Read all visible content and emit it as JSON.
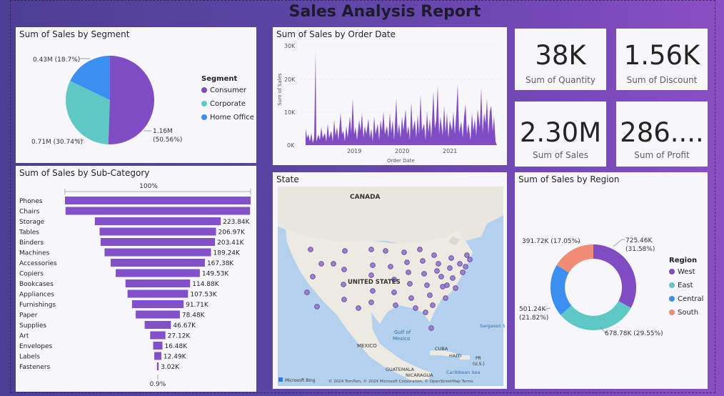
{
  "report_title": "Sales Analysis Report",
  "colors": {
    "consumer": "#7f4cc4",
    "corporate": "#5ec9c4",
    "home_office": "#3b8ff0",
    "south": "#f28b73",
    "bar": "#8250c8"
  },
  "segment": {
    "title": "Sum of Sales by Segment",
    "legend_title": "Segment",
    "legend": [
      "Consumer",
      "Corporate",
      "Home Office"
    ],
    "labels": {
      "consumer_1": "1.16M",
      "consumer_2": "(50.56%)",
      "corporate": "0.71M (30.74%)",
      "home_office": "0.43M (18.7%)"
    }
  },
  "order_date": {
    "title": "Sum of Sales by Order Date",
    "y_label": "Sum of Sales",
    "x_label": "Order Date",
    "y_ticks": [
      "30K",
      "20K",
      "10K",
      "0K"
    ],
    "x_ticks": [
      "2019",
      "2020",
      "2021"
    ]
  },
  "kpis": [
    {
      "value": "38K",
      "label": "Sum of Quantity"
    },
    {
      "value": "1.56K",
      "label": "Sum of Discount"
    },
    {
      "value": "2.30M",
      "label": "Sum of Sales"
    },
    {
      "value": "286....",
      "label": "Sum of Profit"
    }
  ],
  "subcategory": {
    "title": "Sum of Sales by Sub-Category",
    "top_pct": "100%",
    "bottom_pct": "0.9%",
    "items": [
      {
        "name": "Phones",
        "label": ""
      },
      {
        "name": "Chairs",
        "label": ""
      },
      {
        "name": "Storage",
        "label": "223.84K"
      },
      {
        "name": "Tables",
        "label": "206.97K"
      },
      {
        "name": "Binders",
        "label": "203.41K"
      },
      {
        "name": "Machines",
        "label": "189.24K"
      },
      {
        "name": "Accessories",
        "label": "167.38K"
      },
      {
        "name": "Copiers",
        "label": "149.53K"
      },
      {
        "name": "Bookcases",
        "label": "114.88K"
      },
      {
        "name": "Appliances",
        "label": "107.53K"
      },
      {
        "name": "Furnishings",
        "label": "91.71K"
      },
      {
        "name": "Paper",
        "label": "78.48K"
      },
      {
        "name": "Supplies",
        "label": "46.67K"
      },
      {
        "name": "Art",
        "label": "27.12K"
      },
      {
        "name": "Envelopes",
        "label": "16.48K"
      },
      {
        "name": "Labels",
        "label": "12.49K"
      },
      {
        "name": "Fasteners",
        "label": "3.02K"
      }
    ]
  },
  "map": {
    "title": "State",
    "labels": {
      "canada": "CANADA",
      "us": "UNITED STATES",
      "mexico": "MEXICO",
      "gulf1": "Gulf of",
      "gulf2": "Mexico",
      "cuba": "CUBA",
      "haiti": "HAITI",
      "pr1": "PR",
      "pr2": "(U.S.)",
      "guatemala": "GUATEMALA",
      "nicaragua": "NICARAGUA",
      "caribbean": "Caribbean Sea",
      "sargasso": "Sargasso S"
    },
    "bing": "Microsoft Bing",
    "copyright": "© 2024 TomTom, © 2024 Microsoft Corporation, © OpenStreetMap  Terms"
  },
  "region": {
    "title": "Sum of Sales by Region",
    "legend_title": "Region",
    "legend": [
      "West",
      "East",
      "Central",
      "South"
    ],
    "labels": {
      "west_1": "725.46K",
      "west_2": "(31.58%)",
      "east": "678.78K (29.55%)",
      "central_1": "501.24K",
      "central_2": "(21.82%)",
      "south": "391.72K (17.05%)"
    }
  },
  "chart_data": [
    {
      "type": "pie",
      "title": "Sum of Sales by Segment",
      "categories": [
        "Consumer",
        "Corporate",
        "Home Office"
      ],
      "values": [
        1.16,
        0.71,
        0.43
      ],
      "percents": [
        50.56,
        30.74,
        18.7
      ],
      "unit": "M",
      "legend": "right"
    },
    {
      "type": "line",
      "title": "Sum of Sales by Order Date",
      "xlabel": "Order Date",
      "ylabel": "Sum of Sales",
      "ylim": [
        0,
        30000
      ],
      "x_range": [
        "2018",
        "2021"
      ]
    },
    {
      "type": "bar",
      "title": "Sum of Sales by Sub-Category",
      "categories": [
        "Phones",
        "Chairs",
        "Storage",
        "Tables",
        "Binders",
        "Machines",
        "Accessories",
        "Copiers",
        "Bookcases",
        "Appliances",
        "Furnishings",
        "Paper",
        "Supplies",
        "Art",
        "Envelopes",
        "Labels",
        "Fasteners"
      ],
      "values": [
        330000,
        328000,
        223840,
        206970,
        203410,
        189240,
        167380,
        149530,
        114880,
        107530,
        91710,
        78480,
        46670,
        27120,
        16480,
        12490,
        3020
      ]
    },
    {
      "type": "pie",
      "title": "Sum of Sales by Region",
      "categories": [
        "West",
        "East",
        "Central",
        "South"
      ],
      "values": [
        725.46,
        678.78,
        501.24,
        391.72
      ],
      "percents": [
        31.58,
        29.55,
        21.82,
        17.05
      ],
      "unit": "K",
      "legend": "right"
    }
  ]
}
